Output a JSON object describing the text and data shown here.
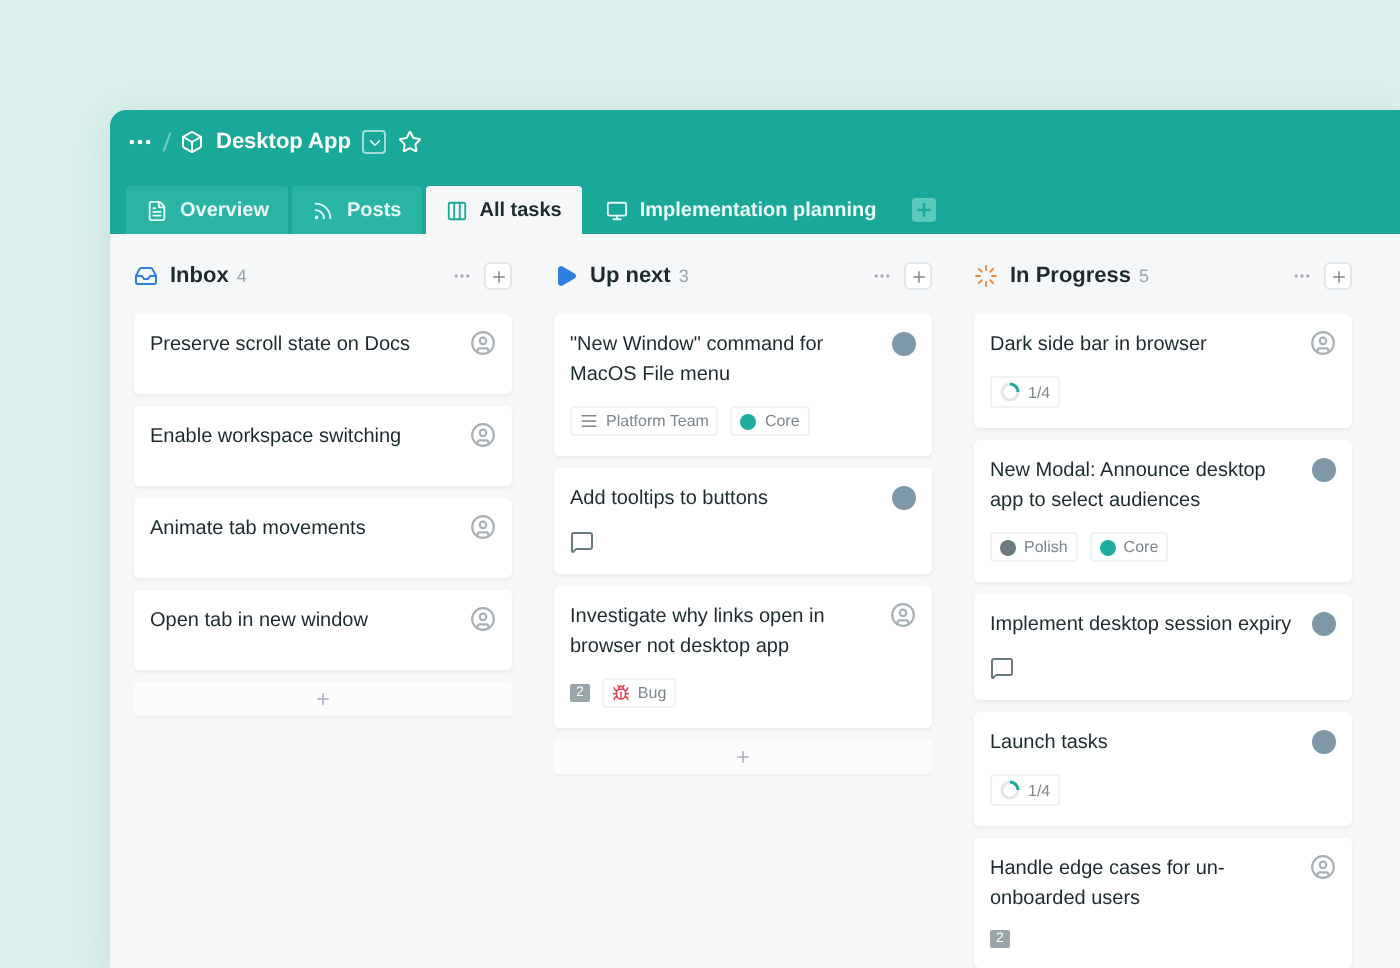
{
  "header": {
    "project": "Desktop App"
  },
  "tabs": [
    {
      "label": "Overview",
      "kind": "doc",
      "selected": false
    },
    {
      "label": "Posts",
      "kind": "feed",
      "selected": false
    },
    {
      "label": "All tasks",
      "kind": "board",
      "selected": true
    },
    {
      "label": "Implementation planning",
      "kind": "screen",
      "selected": false
    }
  ],
  "columns": [
    {
      "title": "Inbox",
      "count": "4",
      "kind": "inbox",
      "cards": [
        {
          "title": "Preserve scroll state on Docs",
          "assigned": false
        },
        {
          "title": "Enable workspace switching",
          "assigned": false
        },
        {
          "title": "Animate tab movements",
          "assigned": false
        },
        {
          "title": "Open tab in new window",
          "assigned": false
        }
      ]
    },
    {
      "title": "Up next",
      "count": "3",
      "kind": "play",
      "cards": [
        {
          "title": "\"New Window\" command for MacOS File menu",
          "assigned": true,
          "meta": [
            {
              "kind": "team",
              "label": "Platform Team"
            },
            {
              "kind": "label",
              "label": "Core",
              "color": "#1fae9e"
            }
          ]
        },
        {
          "title": "Add tooltips to buttons",
          "assigned": true,
          "meta": [
            {
              "kind": "comment"
            }
          ]
        },
        {
          "title": "Investigate why links open in browser not desktop app",
          "assigned": false,
          "meta": [
            {
              "kind": "comments",
              "label": "2"
            },
            {
              "kind": "bug",
              "label": "Bug",
              "color": "#e0445a"
            }
          ]
        }
      ]
    },
    {
      "title": "In Progress",
      "count": "5",
      "kind": "progress",
      "cards": [
        {
          "title": "Dark side bar in browser",
          "assigned": false,
          "meta": [
            {
              "kind": "subtasks",
              "label": "1/4",
              "level": 0.25
            }
          ]
        },
        {
          "title": "New Modal: Announce desktop app to select audiences",
          "assigned": true,
          "meta": [
            {
              "kind": "label",
              "label": "Polish",
              "color": "#6b7a80"
            },
            {
              "kind": "label",
              "label": "Core",
              "color": "#1fae9e"
            }
          ]
        },
        {
          "title": "Implement desktop session expiry",
          "assigned": true,
          "meta": [
            {
              "kind": "comment"
            }
          ]
        },
        {
          "title": "Launch tasks",
          "assigned": true,
          "meta": [
            {
              "kind": "subtasks",
              "label": "1/4",
              "level": 0.25
            }
          ]
        },
        {
          "title": "Handle edge cases for un-onboarded users",
          "assigned": false,
          "meta": [
            {
              "kind": "comments",
              "label": "2"
            }
          ]
        }
      ]
    }
  ]
}
